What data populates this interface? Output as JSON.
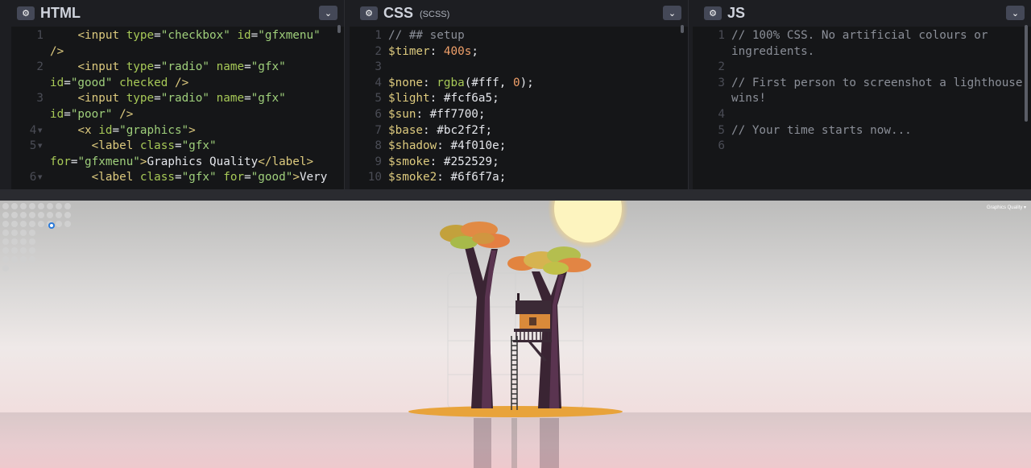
{
  "html_panel": {
    "title": "HTML",
    "lines": [
      {
        "n": "1",
        "html": "    <span class='k-tag'>&lt;input</span> <span class='k-attr'>type</span>=<span class='k-str'>\"checkbox\"</span> <span class='k-attr'>id</span>=<span class='k-str'>\"gfxmenu\"</span>"
      },
      {
        "n": "",
        "html": "<span class='k-tag'>/&gt;</span>"
      },
      {
        "n": "2",
        "html": "    <span class='k-tag'>&lt;input</span> <span class='k-attr'>type</span>=<span class='k-str'>\"radio\"</span> <span class='k-attr'>name</span>=<span class='k-str'>\"gfx\"</span>"
      },
      {
        "n": "",
        "html": "<span class='k-attr'>id</span>=<span class='k-str'>\"good\"</span> <span class='k-attr'>checked</span> <span class='k-tag'>/&gt;</span>"
      },
      {
        "n": "3",
        "html": "    <span class='k-tag'>&lt;input</span> <span class='k-attr'>type</span>=<span class='k-str'>\"radio\"</span> <span class='k-attr'>name</span>=<span class='k-str'>\"gfx\"</span>"
      },
      {
        "n": "",
        "html": "<span class='k-attr'>id</span>=<span class='k-str'>\"poor\"</span> <span class='k-tag'>/&gt;</span>"
      },
      {
        "n": "4▾",
        "html": "    <span class='k-tag'>&lt;x</span> <span class='k-attr'>id</span>=<span class='k-str'>\"graphics\"</span><span class='k-tag'>&gt;</span>"
      },
      {
        "n": "5▾",
        "html": "      <span class='k-tag'>&lt;label</span> <span class='k-attr'>class</span>=<span class='k-str'>\"gfx\"</span>"
      },
      {
        "n": "",
        "html": "<span class='k-attr'>for</span>=<span class='k-str'>\"gfxmenu\"</span><span class='k-tag'>&gt;</span>Graphics Quality<span class='k-tag'>&lt;/label&gt;</span>"
      },
      {
        "n": "6▾",
        "html": "      <span class='k-tag'>&lt;label</span> <span class='k-attr'>class</span>=<span class='k-str'>\"gfx\"</span> <span class='k-attr'>for</span>=<span class='k-str'>\"good\"</span><span class='k-tag'>&gt;</span>Very"
      }
    ]
  },
  "css_panel": {
    "title": "CSS",
    "subtitle": "(SCSS)",
    "lines": [
      {
        "n": "1",
        "html": "<span class='k-comment'>// ## setup</span>"
      },
      {
        "n": "2",
        "html": "<span class='k-var'>$timer</span>: <span class='k-num'>400s</span>;"
      },
      {
        "n": "3",
        "html": ""
      },
      {
        "n": "4",
        "html": "<span class='k-var'>$none</span>: <span class='k-fn'>rgba</span>(<span class='k-val'>#fff</span>, <span class='k-num'>0</span>);"
      },
      {
        "n": "5",
        "html": "<span class='k-var'>$light</span>: <span class='k-val'>#fcf6a5</span>;"
      },
      {
        "n": "6",
        "html": "<span class='k-var'>$sun</span>: <span class='k-val'>#ff7700</span>;"
      },
      {
        "n": "7",
        "html": "<span class='k-var'>$base</span>: <span class='k-val'>#bc2f2f</span>;"
      },
      {
        "n": "8",
        "html": "<span class='k-var'>$shadow</span>: <span class='k-val'>#4f010e</span>;"
      },
      {
        "n": "9",
        "html": "<span class='k-var'>$smoke</span>: <span class='k-val'>#252529</span>;"
      },
      {
        "n": "10",
        "html": "<span class='k-var'>$smoke2</span>: <span class='k-val'>#6f6f7a</span>;"
      }
    ]
  },
  "js_panel": {
    "title": "JS",
    "lines": [
      {
        "n": "1",
        "html": "<span class='k-comment'>// 100% CSS. No artificial colours or</span>"
      },
      {
        "n": "",
        "html": "<span class='k-comment'>ingredients.</span>"
      },
      {
        "n": "2",
        "html": ""
      },
      {
        "n": "3",
        "html": "<span class='k-comment'>// First person to screenshot a lighthouse</span>"
      },
      {
        "n": "",
        "html": "<span class='k-comment'>wins!</span>"
      },
      {
        "n": "4",
        "html": ""
      },
      {
        "n": "5",
        "html": "<span class='k-comment'>// Your time starts now...</span>"
      },
      {
        "n": "6",
        "html": ""
      }
    ]
  },
  "preview": {
    "gfx_menu_label": "Graphics Quality ▾"
  },
  "icons": {
    "gear": "gear-icon",
    "chevron": "chevron-down-icon"
  }
}
